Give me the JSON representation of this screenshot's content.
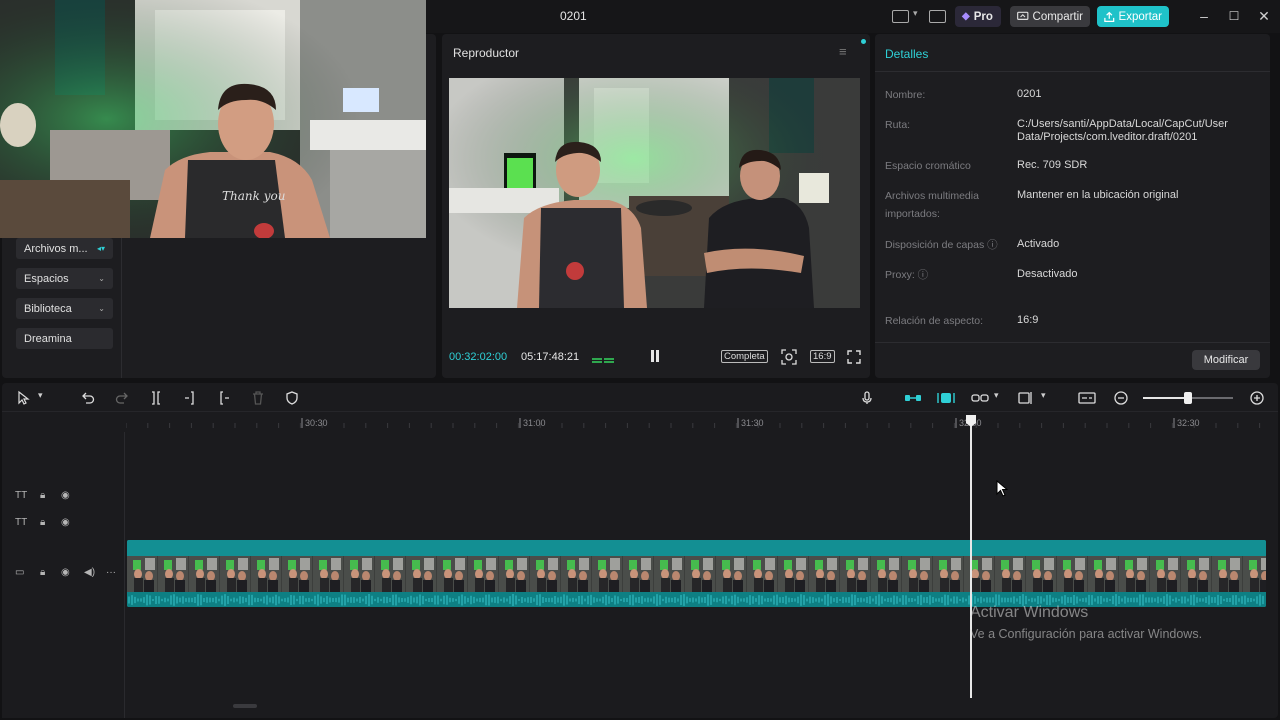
{
  "window": {
    "title": "0201",
    "pro_label": "Pro",
    "share_label": "Compartir",
    "export_label": "Exportar",
    "accent": "#1fc2c9"
  },
  "sidebar": {
    "items": [
      {
        "label": "Archivos m...",
        "icon": "chevron-down-icon"
      },
      {
        "label": "Espacios",
        "icon": "chevron-down-icon"
      },
      {
        "label": "Biblioteca",
        "icon": "chevron-down-icon"
      },
      {
        "label": "Dreamina",
        "icon": ""
      }
    ]
  },
  "player": {
    "title": "Reproductor",
    "current_time": "00:32:02:00",
    "total_time": "05:17:48:21",
    "fit_label": "Completa",
    "ratio_label": "16:9"
  },
  "details": {
    "title": "Detalles",
    "rows": [
      {
        "label": "Nombre:",
        "value": "0201"
      },
      {
        "label": "Ruta:",
        "value": "C:/Users/santi/AppData/Local/CapCut/User Data/Projects/com.lveditor.draft/0201"
      },
      {
        "label": "Espacio cromático",
        "value": "Rec. 709 SDR"
      },
      {
        "label": "Archivos multimedia importados:",
        "value": "Mantener en la ubicación original"
      },
      {
        "label": "Disposición de capas ⓘ",
        "value": "Activado"
      },
      {
        "label": "Proxy: ⓘ",
        "value": "Desactivado"
      },
      {
        "label": "Relación de aspecto:",
        "value": "16:9"
      }
    ],
    "modify_label": "Modificar"
  },
  "timeline": {
    "ruler_labels": [
      "30:30",
      "31:00",
      "31:30",
      "32:00",
      "32:30"
    ]
  },
  "watermark": {
    "title": "Activar Windows",
    "subtitle": "Ve a Configuración para activar Windows."
  }
}
